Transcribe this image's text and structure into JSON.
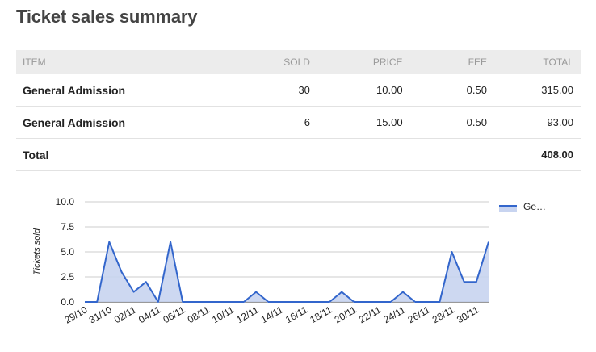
{
  "page": {
    "title": "Ticket sales summary"
  },
  "table": {
    "headers": {
      "item": "ITEM",
      "sold": "SOLD",
      "price": "PRICE",
      "fee": "FEE",
      "total": "TOTAL"
    },
    "rows": [
      {
        "item": "General Admission",
        "sold": "30",
        "price": "10.00",
        "fee": "0.50",
        "total": "315.00"
      },
      {
        "item": "General Admission",
        "sold": "6",
        "price": "15.00",
        "fee": "0.50",
        "total": "93.00"
      }
    ],
    "total_row": {
      "label": "Total",
      "total": "408.00"
    }
  },
  "colors": {
    "series": "#3366cc",
    "area": "#c8d4f0",
    "grid": "#cccccc"
  },
  "chart_data": {
    "type": "area",
    "title": "",
    "xlabel": "",
    "ylabel": "Tickets sold",
    "ylim": [
      0,
      10
    ],
    "yticks": [
      "0.0",
      "2.5",
      "5.0",
      "7.5",
      "10.0"
    ],
    "x": [
      "29/10",
      "30/10",
      "31/10",
      "01/11",
      "02/11",
      "03/11",
      "04/11",
      "05/11",
      "06/11",
      "07/11",
      "08/11",
      "09/11",
      "10/11",
      "11/11",
      "12/11",
      "13/11",
      "14/11",
      "15/11",
      "16/11",
      "17/11",
      "18/11",
      "19/11",
      "20/11",
      "21/11",
      "22/11",
      "23/11",
      "24/11",
      "25/11",
      "26/11",
      "27/11",
      "28/11",
      "29/11",
      "30/11",
      "01/12"
    ],
    "xtick_labels": [
      "29/10",
      "31/10",
      "02/11",
      "04/11",
      "06/11",
      "08/11",
      "10/11",
      "12/11",
      "14/11",
      "16/11",
      "18/11",
      "20/11",
      "22/11",
      "24/11",
      "26/11",
      "28/11",
      "30/11"
    ],
    "series": [
      {
        "name": "Ge…",
        "values": [
          0,
          0,
          6,
          3,
          1,
          2,
          0,
          6,
          0,
          0,
          0,
          0,
          0,
          0,
          1,
          0,
          0,
          0,
          0,
          0,
          0,
          1,
          0,
          0,
          0,
          0,
          1,
          0,
          0,
          0,
          5,
          2,
          2,
          6
        ]
      }
    ],
    "grid": true,
    "legend_position": "right"
  }
}
